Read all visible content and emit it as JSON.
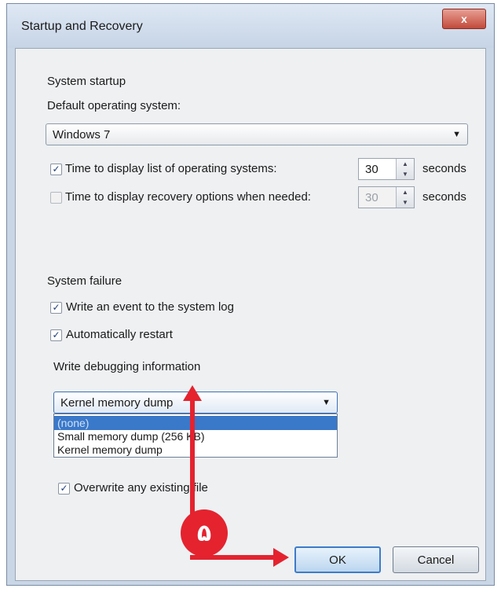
{
  "window": {
    "title": "Startup and Recovery",
    "close_label": "x"
  },
  "system_startup": {
    "group_label": "System startup",
    "default_os_label": "Default operating system:",
    "default_os_value": "Windows 7",
    "display_list": {
      "checked": true,
      "label": "Time to display list of operating systems:",
      "value": "30",
      "unit": "seconds"
    },
    "display_recovery": {
      "checked": false,
      "label": "Time to display recovery options when needed:",
      "value": "30",
      "unit": "seconds"
    }
  },
  "system_failure": {
    "group_label": "System failure",
    "write_event": {
      "checked": true,
      "label": "Write an event to the system log"
    },
    "auto_restart": {
      "checked": true,
      "label": "Automatically restart"
    },
    "debug_label": "Write debugging information",
    "debug_value": "Kernel memory dump",
    "debug_options": [
      "(none)",
      "Small memory dump (256 KB)",
      "Kernel memory dump"
    ],
    "overwrite": {
      "checked": true,
      "label": "Overwrite any existing file"
    }
  },
  "buttons": {
    "ok": "OK",
    "cancel": "Cancel"
  },
  "annotation": {
    "step_number": "۵",
    "color": "#e4232f"
  },
  "icons": {
    "check": "✓",
    "dropdown": "▼",
    "spin_up": "▲",
    "spin_down": "▼"
  }
}
